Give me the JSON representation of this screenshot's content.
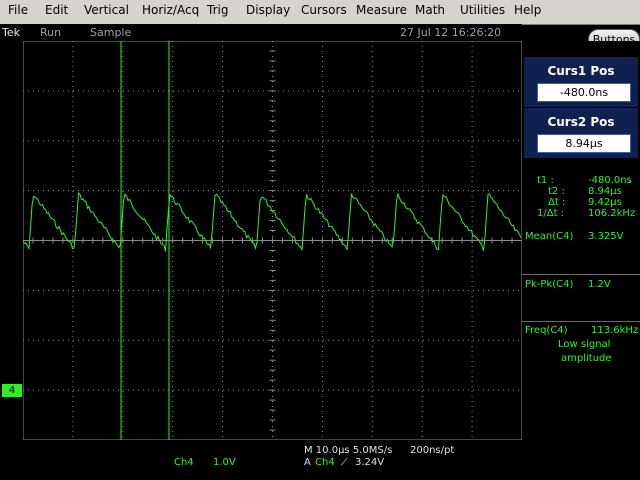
{
  "menu": [
    "File",
    "Edit",
    "Vertical",
    "Horiz/Acq",
    "Trig",
    "Display",
    "Cursors",
    "Measure",
    "Math",
    "Utilities",
    "Help"
  ],
  "status": {
    "brand": "Tek",
    "run_state": "Run",
    "acq_mode": "Sample",
    "datetime": "27 Jul 12 16:26:20"
  },
  "buttons_label": "Buttons",
  "cursors": {
    "c1_title": "Curs1 Pos",
    "c1_value": "-480.0ns",
    "c2_title": "Curs2 Pos",
    "c2_value": "8.94µs",
    "readout_labels": [
      "t1 :",
      "t2 :",
      "Δt :",
      "1/Δt :"
    ],
    "readout_values": [
      "-480.0ns",
      "8.94µs",
      "9.42µs",
      "106.2kHz"
    ]
  },
  "measurements": {
    "mean_label": "Mean(C4)",
    "mean_value": "3.325V",
    "pkpk_label": "Pk-Pk(C4)",
    "pkpk_value": "1.2V",
    "freq_label": "Freq(C4)",
    "freq_value": "113.6kHz",
    "freq_note_1": "Low signal",
    "freq_note_2": "amplitude"
  },
  "channel": {
    "marker": "4",
    "name": "Ch4",
    "scale": "1.0V"
  },
  "timebase": {
    "line1": "M 10.0µs 5.0MS/s",
    "resolution": "200ns/pt",
    "trig_prefix": "A",
    "trig_channel": "Ch4",
    "trig_slope": "⟋",
    "trig_level": "3.24V"
  },
  "colors": {
    "trace": "#2df02d",
    "cursor": "#2df02d",
    "grid": "#8c8c8c",
    "trigger_marker": "#ff8c1a"
  }
}
